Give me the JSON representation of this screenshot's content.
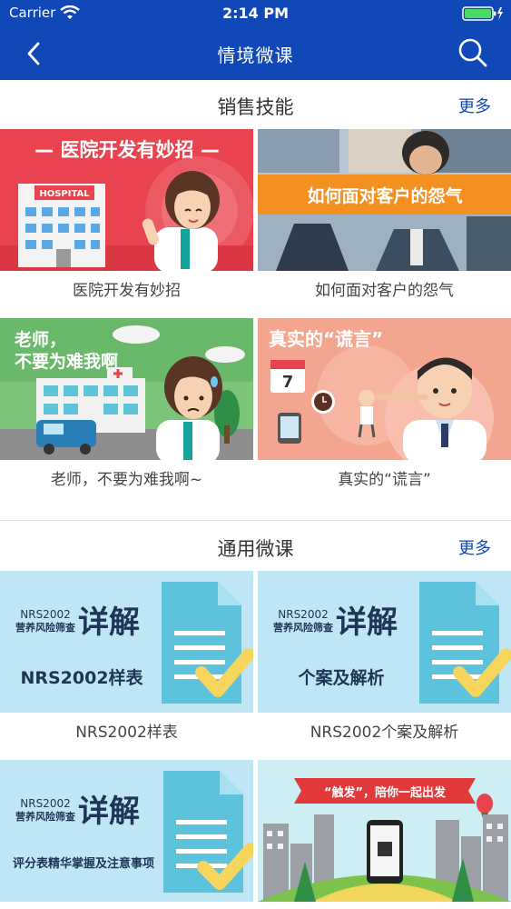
{
  "status_bar": {
    "carrier": "Carrier",
    "time": "2:14 PM"
  },
  "nav": {
    "title": "情境微课"
  },
  "sections": [
    {
      "title": "销售技能",
      "more": "更多",
      "items": [
        {
          "caption": "医院开发有妙招",
          "banner": "— 医院开发有妙招 —",
          "sign": "HOSPITAL"
        },
        {
          "caption": "如何面对客户的怨气",
          "banner": "如何面对客户的怨气"
        },
        {
          "caption": "老师，不要为难我啊~",
          "banner_line1": "老师，",
          "banner_line2": "不要为难我啊"
        },
        {
          "caption": "真实的“谎言”",
          "banner": "真实的“谎言”",
          "calendar_day": "7"
        }
      ]
    },
    {
      "title": "通用微课",
      "more": "更多",
      "items": [
        {
          "caption": "NRS2002样表",
          "line1": "NRS2002",
          "line2": "营养风险筛查",
          "big": "详解",
          "sub": "NRS2002样表"
        },
        {
          "caption": "NRS2002个案及解析",
          "line1": "NRS2002",
          "line2": "营养风险筛查",
          "big": "详解",
          "sub": "个案及解析"
        },
        {
          "caption": "",
          "line1": "NRS2002",
          "line2": "营养风险筛查",
          "big": "详解",
          "sub": "评分表精华掌握及注意事项"
        },
        {
          "caption": "",
          "banner": "“触发”，陪你一起出发"
        }
      ]
    }
  ],
  "colors": {
    "nav_bg": "#1148b7",
    "link": "#1148b7",
    "hospital_bg": "#e8434f",
    "nrs_bg": "#bfe6f5"
  }
}
